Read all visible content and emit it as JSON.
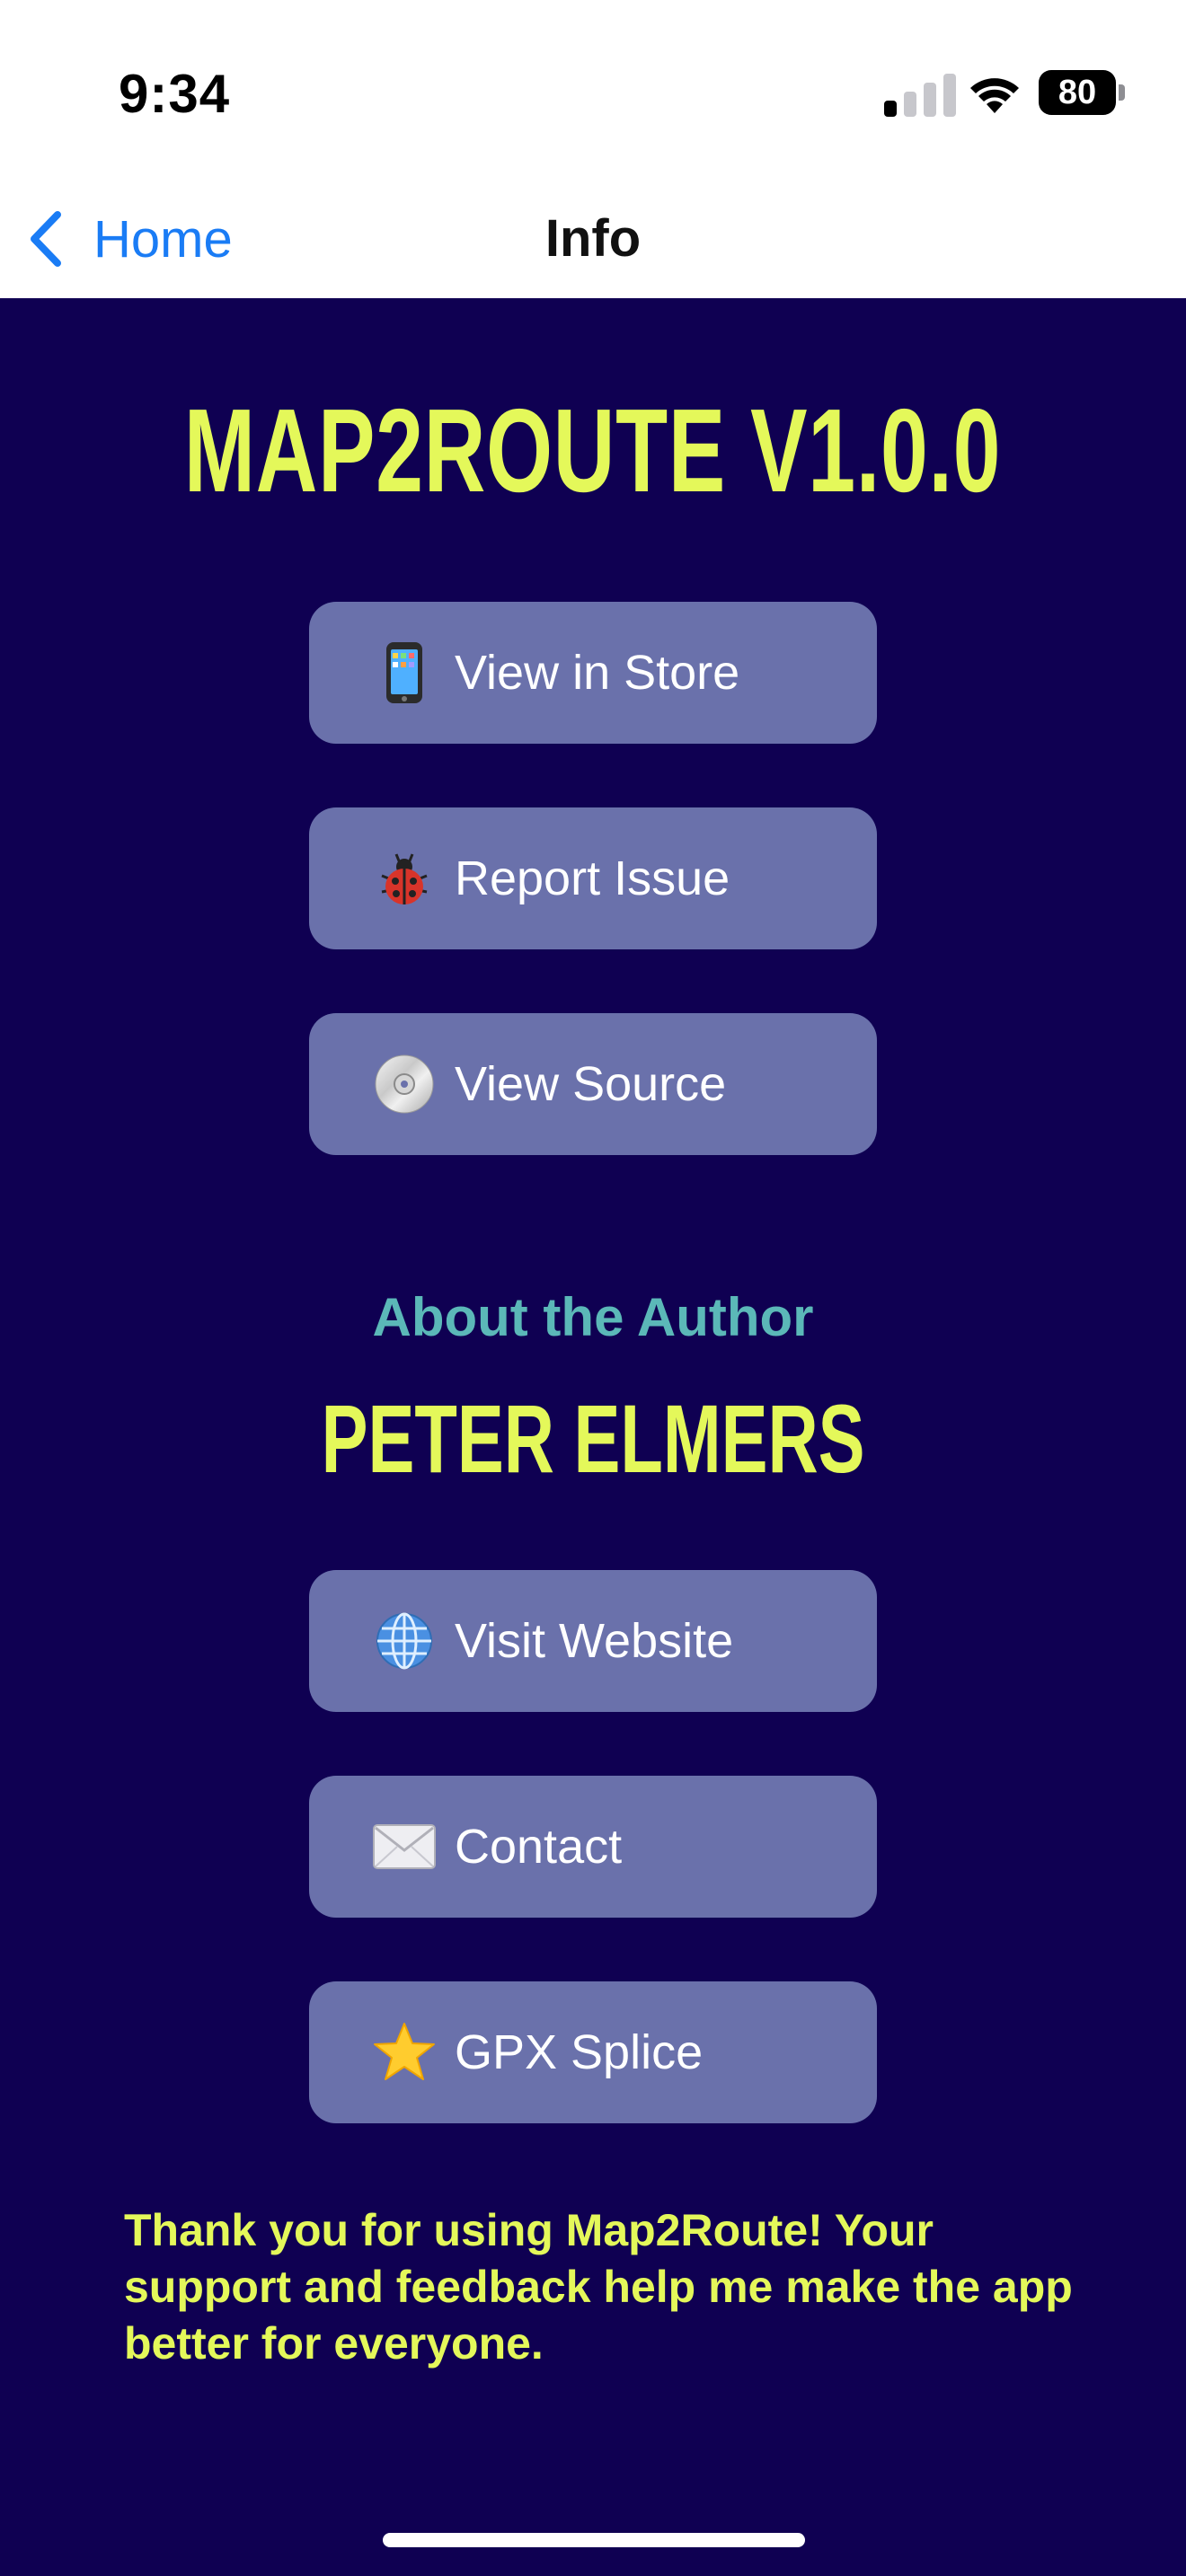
{
  "status_bar": {
    "time": "9:34",
    "battery_level": "80",
    "icons": [
      "cellular-signal-icon",
      "wifi-icon",
      "battery-icon"
    ]
  },
  "nav": {
    "back_label": "Home",
    "title": "Info"
  },
  "app": {
    "title": "MAP2ROUTE V1.0.0"
  },
  "app_buttons": [
    {
      "icon": "mobile-phone-icon",
      "label": "View in Store"
    },
    {
      "icon": "ladybug-icon",
      "label": "Report Issue"
    },
    {
      "icon": "optical-disc-icon",
      "label": "View Source"
    }
  ],
  "author": {
    "heading": "About the Author",
    "name": "PETER ELMERS"
  },
  "author_buttons": [
    {
      "icon": "globe-icon",
      "label": "Visit Website"
    },
    {
      "icon": "envelope-icon",
      "label": "Contact"
    },
    {
      "icon": "star-icon",
      "label": "GPX Splice"
    }
  ],
  "footer": {
    "thanks": "Thank you for using Map2Route! Your support and feedback help me make the app better for everyone."
  },
  "colors": {
    "background": "#0f0052",
    "accent_yellow": "#e4f85a",
    "button_bg": "#6a71ab",
    "heading_teal": "#5bb8b8",
    "link_blue": "#1a7cf5"
  }
}
